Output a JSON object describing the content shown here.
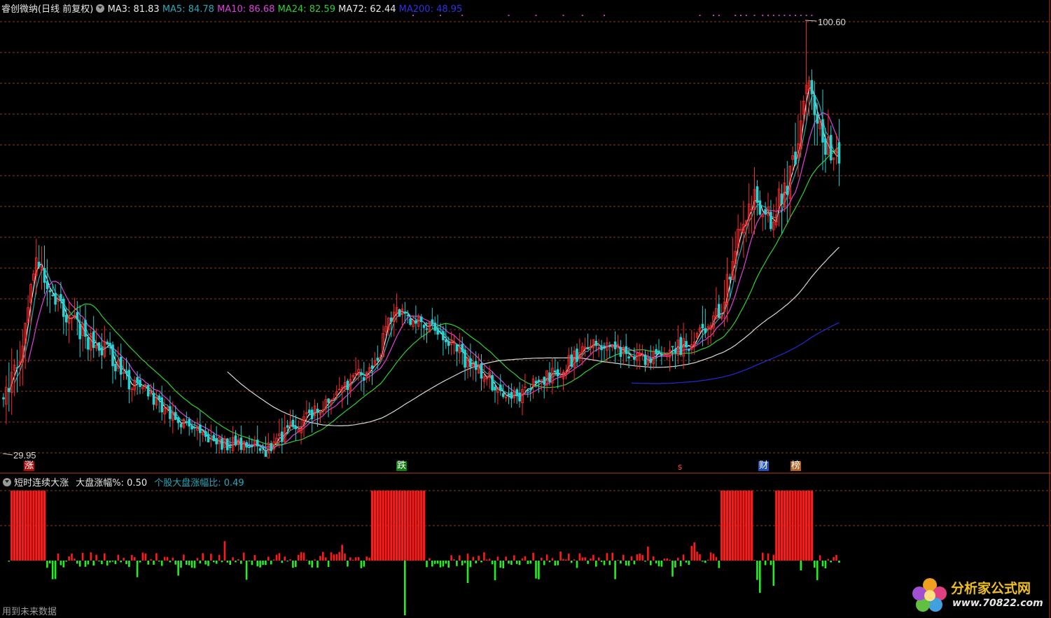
{
  "header": {
    "title": "睿创微纳(日线 前复权)",
    "ma": [
      {
        "label": "MA3: 81.83",
        "color": "#e8e8e8"
      },
      {
        "label": "MA5: 84.78",
        "color": "#2aa8b8"
      },
      {
        "label": "MA10: 86.68",
        "color": "#e040e0"
      },
      {
        "label": "MA24: 82.59",
        "color": "#30d030"
      },
      {
        "label": "MA72: 62.44",
        "color": "#e8e8e8"
      },
      {
        "label": "MA200: 48.95",
        "color": "#3030e8"
      }
    ]
  },
  "price_labels": {
    "high": "100.60",
    "low": "29.95"
  },
  "markers": {
    "zhang": "涨",
    "die": "跌",
    "s": "s",
    "cai": "财",
    "bang": "榜"
  },
  "indicator": {
    "name": "短时连续大涨",
    "param_label": "大盘涨幅%: 0.50",
    "ratio_label": "个股大盘涨幅比: 0.49"
  },
  "footer_note": "用到未来数据",
  "logo": {
    "text": "分析家公式网",
    "url_text": "www.70822.com"
  },
  "colors": {
    "up": "#ff2a2a",
    "down": "#22d4d4",
    "grid": "#8a3c1a",
    "ma5": "#2aa8b8",
    "ma10": "#e040e0",
    "ma24": "#30d030",
    "ma72": "#d8d8d8",
    "ma200": "#2828d8",
    "ind_up": "#ff1a1a",
    "ind_down": "#22ee22",
    "dots": "#c040c0"
  },
  "chart_data": [
    {
      "type": "candlestick",
      "title": "睿创微纳(日线 前复权)",
      "ylim": [
        29.95,
        100.6
      ],
      "series_names": [
        "MA3",
        "MA5",
        "MA10",
        "MA24",
        "MA72",
        "MA200"
      ],
      "last_values": {
        "MA3": 81.83,
        "MA5": 84.78,
        "MA10": 86.68,
        "MA24": 82.59,
        "MA72": 62.44,
        "MA200": 48.95
      },
      "annotations": [
        "100.60",
        "29.95",
        "涨",
        "跌",
        "s",
        "财",
        "榜"
      ],
      "close_anchors": [
        [
          0,
          40
        ],
        [
          5,
          43
        ],
        [
          12,
          62
        ],
        [
          18,
          55
        ],
        [
          25,
          52
        ],
        [
          32,
          48
        ],
        [
          38,
          47
        ],
        [
          45,
          42
        ],
        [
          52,
          40
        ],
        [
          60,
          37
        ],
        [
          68,
          34
        ],
        [
          78,
          32
        ],
        [
          88,
          31
        ],
        [
          97,
          30.5
        ],
        [
          105,
          34
        ],
        [
          112,
          36
        ],
        [
          120,
          38
        ],
        [
          128,
          42
        ],
        [
          136,
          44
        ],
        [
          143,
          54
        ],
        [
          150,
          52
        ],
        [
          158,
          51
        ],
        [
          165,
          47
        ],
        [
          172,
          44
        ],
        [
          178,
          42
        ],
        [
          184,
          38
        ],
        [
          190,
          40
        ],
        [
          198,
          42
        ],
        [
          205,
          44
        ],
        [
          212,
          47
        ],
        [
          220,
          48
        ],
        [
          228,
          46
        ],
        [
          235,
          45
        ],
        [
          242,
          46
        ],
        [
          250,
          48
        ],
        [
          258,
          50
        ],
        [
          264,
          55
        ],
        [
          268,
          65
        ],
        [
          274,
          72
        ],
        [
          280,
          68
        ],
        [
          285,
          72
        ],
        [
          290,
          78
        ],
        [
          294,
          90
        ],
        [
          298,
          86
        ],
        [
          302,
          79
        ],
        [
          306,
          78
        ]
      ],
      "volatility_anchors": [
        [
          0,
          5
        ],
        [
          20,
          4
        ],
        [
          60,
          2.5
        ],
        [
          130,
          3
        ],
        [
          150,
          3
        ],
        [
          235,
          2.5
        ],
        [
          260,
          4
        ],
        [
          306,
          7
        ]
      ]
    },
    {
      "type": "bar",
      "title": "短时连续大涨",
      "params": {
        "大盘涨幅%": 0.5,
        "个股大盘涨幅比": 0.49
      },
      "baseline": 0,
      "full_red_ranges": [
        [
          3,
          15
        ],
        [
          135,
          154
        ],
        [
          263,
          274
        ],
        [
          283,
          296
        ]
      ]
    }
  ]
}
